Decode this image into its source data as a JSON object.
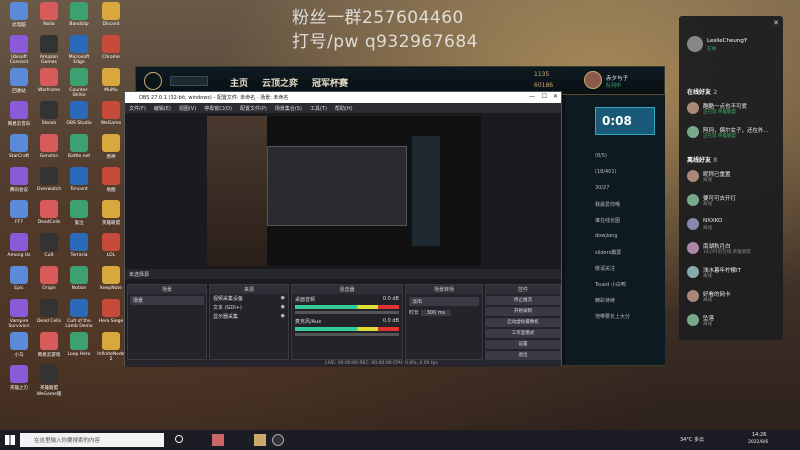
{
  "overlay": {
    "line1": "粉丝一群257604460",
    "line2": "打号/pw q932967684"
  },
  "desktop_icons": [
    "此电脑",
    "Nolia",
    "Bandizip",
    "Discord",
    "Ubisoft Connect",
    "Amazon Games",
    "Microsoft Edge",
    "Chrome",
    "回收站",
    "Warframe",
    "Counter-Strike",
    "MuMu",
    "网易云音乐",
    "Steam",
    "OBS Studio",
    "WeGame",
    "StarCraft",
    "Genshin",
    "Battle.net",
    "原神",
    "腾讯会议",
    "Overwatch",
    "Tencent",
    "地图",
    "FF7",
    "DeadCells",
    "鬼泣",
    "英雄联盟",
    "Among Us",
    "Cult",
    "Terraria",
    "LOL",
    "Epic",
    "Origin",
    "Notion",
    "KeepNote",
    "Vampire Survivors",
    "Dead Cells",
    "Cult of the Lamb Demo",
    "Hero Siege",
    "小马",
    "网易云游戏",
    "Loop Hero",
    "InfiniteNode 2",
    "英雄之刃",
    "英雄联盟 WeGame版"
  ],
  "lol": {
    "tab_home": "主页",
    "tab_cloud": "云顶之弈",
    "tab_cup": "冠军杯赛",
    "currency": "60186",
    "points": "1135",
    "username": "赤夕与子",
    "status": "队列中"
  },
  "obs": {
    "title": "OBS 27.0.1 (32-bit, windows) - 配置文件: 未命名 - 场景: 未命名",
    "menu": [
      "文件(F)",
      "编辑(E)",
      "视图(V)",
      "停靠窗口(D)",
      "配置文件(P)",
      "场景集合(S)",
      "工具(T)",
      "帮助(H)"
    ],
    "no_source": "未选择源",
    "scenes_title": "场景",
    "scenes": [
      "场景"
    ],
    "sources_title": "来源",
    "sources": [
      "视频采集设备",
      "文本 (GDI+)",
      "显示器采集"
    ],
    "mixer_title": "混音器",
    "mixer": [
      {
        "name": "桌面音频",
        "db": "0.0 dB"
      },
      {
        "name": "麦克风/Aux",
        "db": "0.0 dB"
      }
    ],
    "transitions_title": "场景转场",
    "transition": "淡出",
    "duration_label": "时长",
    "duration": "300 ms",
    "controls_title": "控件",
    "controls": [
      "停止推流",
      "开始录制",
      "启动虚拟摄像机",
      "工作室模式",
      "设置",
      "退出"
    ],
    "status": "LIVE: 00:00:00  REC: 00:00:00  CPU: 0.0%, 0.00 fps"
  },
  "rightcol": {
    "timer": "0:08",
    "lines": [
      "(8/5)",
      "(18/401)",
      "30/27",
      "我最爱你哦",
      "谁在线长图",
      "dowjiang",
      "sliders霸屏",
      "敬请关注",
      "Tsued 小白鸭",
      "精彩待续",
      "地带要长上大分"
    ]
  },
  "friends": {
    "user": "LeslieCheungY",
    "user_status": "在线",
    "online_header": "在线好友",
    "online_count": "2",
    "online": [
      {
        "name": "酷酷一点也不可爱",
        "status": "正在玩 英雄联盟"
      },
      {
        "name": "阿珂，偶尔女子，还在外...",
        "status": "正在玩 英雄联盟"
      }
    ],
    "offline_header": "离线好友",
    "offline_count": "8",
    "offline": [
      {
        "name": "昵称已重置",
        "status": "离线"
      },
      {
        "name": "要可可去开打",
        "status": "离线"
      },
      {
        "name": "NXXKO",
        "status": "离线"
      },
      {
        "name": "南湖秋月白",
        "status": "14小时前在线 英雄联盟"
      },
      {
        "name": "浅水暮年柠檬IT",
        "status": "离线"
      },
      {
        "name": "好看的网卡",
        "status": "离线"
      },
      {
        "name": "坠落",
        "status": "离线"
      }
    ]
  },
  "taskbar": {
    "search": "在这里输入你要搜索的内容",
    "weather": "34°C 多云",
    "time": "14:26",
    "date": "2022/8/6"
  },
  "colors": {
    "lol_gold": "#c8aa6e",
    "obs_bg": "#1b1b1f",
    "friends_green": "#3cb371",
    "timer_bg": "#1aa0c8"
  }
}
